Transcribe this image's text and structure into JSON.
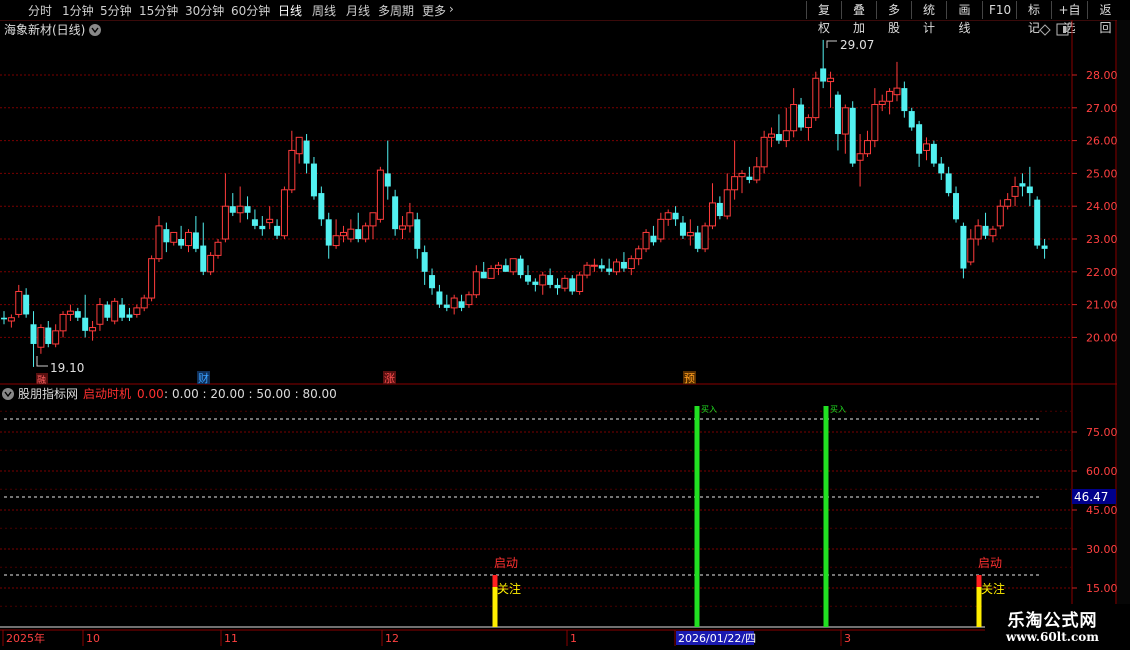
{
  "toolbar": {
    "periods": [
      "分时",
      "1分钟",
      "5分钟",
      "15分钟",
      "30分钟",
      "60分钟",
      "日线",
      "周线",
      "月线",
      "多周期",
      "更多"
    ],
    "active_period": "日线",
    "right_buttons": [
      "复权",
      "叠加",
      "多股",
      "统计",
      "画线",
      "F10",
      "标记",
      "+自选",
      "返回"
    ]
  },
  "chart_header": {
    "title": "海象新材(日线)"
  },
  "price_axis": {
    "labels": [
      "28.00",
      "27.00",
      "26.00",
      "25.00",
      "24.00",
      "23.00",
      "22.00",
      "21.00",
      "20.00"
    ]
  },
  "annotations": {
    "high": "29.07",
    "low": "19.10"
  },
  "event_markers": [
    {
      "text": "财",
      "color": "#3aa0ff"
    },
    {
      "text": "涨",
      "color": "#ff4040"
    },
    {
      "text": "预",
      "color": "#ffa020"
    }
  ],
  "low_marker_glyph": "融",
  "indicator": {
    "name": "股朋指标网",
    "line_name": "启动时机",
    "line_value": "0.00",
    "levels": [
      "0.00",
      "20.00",
      "50.00",
      "80.00"
    ],
    "axis_labels": [
      "75.00",
      "60.00",
      "45.00",
      "30.00",
      "15.00"
    ],
    "current_value": "46.47",
    "signal_start": "启动",
    "signal_watch": "关注",
    "bar_top_label": "买入"
  },
  "date_axis": {
    "labels": [
      "2025年",
      "10",
      "11",
      "12",
      "1",
      "2026/01/22/四",
      "3"
    ]
  },
  "watermark": {
    "title": "乐淘公式网",
    "url": "www.60lt.com"
  },
  "colors": {
    "up": "#ff3c3c",
    "down": "#52f0f0",
    "grid": "#7a0000",
    "green_signal": "#22e022",
    "yellow_signal": "#ffee00",
    "red_signal": "#ff2020"
  },
  "chart_data": {
    "type": "candlestick",
    "title": "海象新材(日线)",
    "ylim": [
      19.1,
      29.07
    ],
    "x_labels": [
      "2025年",
      "10",
      "11",
      "12",
      "1",
      "2026/01/22/四",
      "3"
    ],
    "ohlc": [
      [
        20.6,
        20.8,
        20.4,
        20.55
      ],
      [
        20.5,
        20.7,
        20.3,
        20.6
      ],
      [
        20.7,
        21.6,
        20.6,
        21.4
      ],
      [
        21.3,
        21.5,
        20.6,
        20.7
      ],
      [
        20.4,
        20.8,
        19.1,
        19.8
      ],
      [
        19.7,
        20.4,
        19.5,
        20.3
      ],
      [
        20.3,
        20.5,
        19.7,
        19.8
      ],
      [
        19.8,
        20.4,
        19.7,
        20.2
      ],
      [
        20.2,
        20.8,
        20.0,
        20.7
      ],
      [
        20.7,
        21.0,
        20.5,
        20.8
      ],
      [
        20.8,
        20.9,
        20.5,
        20.6
      ],
      [
        20.6,
        21.3,
        20.0,
        20.2
      ],
      [
        20.2,
        20.5,
        19.9,
        20.3
      ],
      [
        20.4,
        21.2,
        20.2,
        21.0
      ],
      [
        21.0,
        21.1,
        20.5,
        20.6
      ],
      [
        20.5,
        21.2,
        20.4,
        21.1
      ],
      [
        21.0,
        21.2,
        20.5,
        20.6
      ],
      [
        20.7,
        20.9,
        20.5,
        20.6
      ],
      [
        20.7,
        21.0,
        20.6,
        20.9
      ],
      [
        20.9,
        21.3,
        20.8,
        21.2
      ],
      [
        21.2,
        22.5,
        21.1,
        22.4
      ],
      [
        22.4,
        23.7,
        22.3,
        23.4
      ],
      [
        23.3,
        23.5,
        22.6,
        22.9
      ],
      [
        22.9,
        23.2,
        22.8,
        23.2
      ],
      [
        23.0,
        23.4,
        22.7,
        22.8
      ],
      [
        22.8,
        23.3,
        22.6,
        23.2
      ],
      [
        23.2,
        23.7,
        22.6,
        22.7
      ],
      [
        22.8,
        23.5,
        21.9,
        22.0
      ],
      [
        22.0,
        22.6,
        21.9,
        22.5
      ],
      [
        22.5,
        23.0,
        22.4,
        22.9
      ],
      [
        23.0,
        25.0,
        22.9,
        24.0
      ],
      [
        24.0,
        24.4,
        23.7,
        23.8
      ],
      [
        23.8,
        24.6,
        23.5,
        24.0
      ],
      [
        24.0,
        24.3,
        23.6,
        23.8
      ],
      [
        23.6,
        23.9,
        23.3,
        23.4
      ],
      [
        23.4,
        23.7,
        23.1,
        23.3
      ],
      [
        23.5,
        24.0,
        23.3,
        23.6
      ],
      [
        23.4,
        23.6,
        23.0,
        23.1
      ],
      [
        23.1,
        24.6,
        23.0,
        24.5
      ],
      [
        24.5,
        26.3,
        24.4,
        25.7
      ],
      [
        25.6,
        26.0,
        25.3,
        26.1
      ],
      [
        26.0,
        26.2,
        25.0,
        25.3
      ],
      [
        25.3,
        25.5,
        24.2,
        24.3
      ],
      [
        24.4,
        24.6,
        23.4,
        23.6
      ],
      [
        23.6,
        23.8,
        22.4,
        22.8
      ],
      [
        22.8,
        23.6,
        22.7,
        23.1
      ],
      [
        23.1,
        23.4,
        22.9,
        23.2
      ],
      [
        23.0,
        23.6,
        22.9,
        23.3
      ],
      [
        23.3,
        23.8,
        22.9,
        23.0
      ],
      [
        23.0,
        23.5,
        22.9,
        23.4
      ],
      [
        23.4,
        23.8,
        23.0,
        23.8
      ],
      [
        23.6,
        25.2,
        23.5,
        25.1
      ],
      [
        25.0,
        26.0,
        24.2,
        24.6
      ],
      [
        24.3,
        24.5,
        23.1,
        23.3
      ],
      [
        23.3,
        23.7,
        23.0,
        23.4
      ],
      [
        23.4,
        24.1,
        23.2,
        23.8
      ],
      [
        23.6,
        23.8,
        22.4,
        22.7
      ],
      [
        22.6,
        22.8,
        21.6,
        22.0
      ],
      [
        21.9,
        22.1,
        21.3,
        21.5
      ],
      [
        21.4,
        21.6,
        20.9,
        21.0
      ],
      [
        21.0,
        21.3,
        20.8,
        20.9
      ],
      [
        20.9,
        21.3,
        20.7,
        21.2
      ],
      [
        21.1,
        21.3,
        20.8,
        20.9
      ],
      [
        21.0,
        21.4,
        20.9,
        21.3
      ],
      [
        21.3,
        22.2,
        21.2,
        22.0
      ],
      [
        22.0,
        22.3,
        21.8,
        21.8
      ],
      [
        21.8,
        22.2,
        21.8,
        22.1
      ],
      [
        22.1,
        22.3,
        21.9,
        22.2
      ],
      [
        22.2,
        22.4,
        22.0,
        22.0
      ],
      [
        22.0,
        22.4,
        21.9,
        22.4
      ],
      [
        22.4,
        22.5,
        21.8,
        21.9
      ],
      [
        21.9,
        22.2,
        21.6,
        21.7
      ],
      [
        21.7,
        21.8,
        21.4,
        21.6
      ],
      [
        21.6,
        22.0,
        21.3,
        21.9
      ],
      [
        21.9,
        22.1,
        21.5,
        21.6
      ],
      [
        21.6,
        21.8,
        21.3,
        21.5
      ],
      [
        21.5,
        21.9,
        21.4,
        21.8
      ],
      [
        21.8,
        21.9,
        21.3,
        21.4
      ],
      [
        21.4,
        22.0,
        21.3,
        21.9
      ],
      [
        21.9,
        22.3,
        21.8,
        22.2
      ],
      [
        22.2,
        22.4,
        22.0,
        22.2
      ],
      [
        22.2,
        22.4,
        22.0,
        22.1
      ],
      [
        22.1,
        22.4,
        21.9,
        22.0
      ],
      [
        22.0,
        22.4,
        21.9,
        22.3
      ],
      [
        22.3,
        22.6,
        22.0,
        22.1
      ],
      [
        22.1,
        22.5,
        21.9,
        22.4
      ],
      [
        22.4,
        22.8,
        22.2,
        22.7
      ],
      [
        22.7,
        23.3,
        22.6,
        23.2
      ],
      [
        23.1,
        23.4,
        22.8,
        22.9
      ],
      [
        23.0,
        23.8,
        22.9,
        23.6
      ],
      [
        23.6,
        23.9,
        23.4,
        23.8
      ],
      [
        23.8,
        24.0,
        23.4,
        23.6
      ],
      [
        23.5,
        23.7,
        23.0,
        23.1
      ],
      [
        23.1,
        23.6,
        22.8,
        23.2
      ],
      [
        23.2,
        23.4,
        22.6,
        22.7
      ],
      [
        22.7,
        23.5,
        22.6,
        23.4
      ],
      [
        23.4,
        24.7,
        23.3,
        24.1
      ],
      [
        24.1,
        24.3,
        23.6,
        23.7
      ],
      [
        23.7,
        25.0,
        23.6,
        24.5
      ],
      [
        24.5,
        26.0,
        24.2,
        24.9
      ],
      [
        24.9,
        25.1,
        24.4,
        25.0
      ],
      [
        24.9,
        25.2,
        24.7,
        24.8
      ],
      [
        24.8,
        25.5,
        24.7,
        25.2
      ],
      [
        25.2,
        26.3,
        25.0,
        26.1
      ],
      [
        26.1,
        26.4,
        25.8,
        26.2
      ],
      [
        26.2,
        26.8,
        25.9,
        26.0
      ],
      [
        26.0,
        27.0,
        25.8,
        26.3
      ],
      [
        26.3,
        27.6,
        26.1,
        27.1
      ],
      [
        27.1,
        27.3,
        26.3,
        26.4
      ],
      [
        26.4,
        26.8,
        26.0,
        26.7
      ],
      [
        26.7,
        28.1,
        26.6,
        27.9
      ],
      [
        28.2,
        29.07,
        27.6,
        27.8
      ],
      [
        27.8,
        28.1,
        27.0,
        27.9
      ],
      [
        27.4,
        27.5,
        25.7,
        26.2
      ],
      [
        26.2,
        27.1,
        25.6,
        27.0
      ],
      [
        27.0,
        27.2,
        25.2,
        25.3
      ],
      [
        25.4,
        26.2,
        24.6,
        25.6
      ],
      [
        25.6,
        26.3,
        25.5,
        26.0
      ],
      [
        26.0,
        27.6,
        25.8,
        27.1
      ],
      [
        27.1,
        27.4,
        26.9,
        27.2
      ],
      [
        27.2,
        27.6,
        26.8,
        27.5
      ],
      [
        27.4,
        28.4,
        27.2,
        27.6
      ],
      [
        27.6,
        27.8,
        26.7,
        26.9
      ],
      [
        26.9,
        27.0,
        26.3,
        26.4
      ],
      [
        26.5,
        26.6,
        25.2,
        25.6
      ],
      [
        25.7,
        26.1,
        25.4,
        25.9
      ],
      [
        25.9,
        26.0,
        25.2,
        25.3
      ],
      [
        25.3,
        25.5,
        24.8,
        25.0
      ],
      [
        25.0,
        25.2,
        24.3,
        24.4
      ],
      [
        24.4,
        24.6,
        23.5,
        23.6
      ],
      [
        23.4,
        23.5,
        21.8,
        22.1
      ],
      [
        22.3,
        23.3,
        22.2,
        23.0
      ],
      [
        23.0,
        23.6,
        22.8,
        23.4
      ],
      [
        23.4,
        23.8,
        23.0,
        23.1
      ],
      [
        23.1,
        23.4,
        22.9,
        23.3
      ],
      [
        23.4,
        24.2,
        23.3,
        24.0
      ],
      [
        24.0,
        24.4,
        23.9,
        24.2
      ],
      [
        24.3,
        24.9,
        24.0,
        24.6
      ],
      [
        24.7,
        25.0,
        24.3,
        24.6
      ],
      [
        24.6,
        25.2,
        24.0,
        24.4
      ],
      [
        24.2,
        24.3,
        22.7,
        22.8
      ],
      [
        22.8,
        23.0,
        22.4,
        22.7
      ]
    ],
    "indicator_series": {
      "name": "启动时机",
      "levels": [
        0,
        20,
        50,
        80
      ],
      "ylim": [
        0,
        85
      ],
      "events": [
        {
          "bar_index": 0,
          "type": "启动",
          "value": 20
        },
        {
          "bar_index": 1,
          "type": "买入",
          "value": 85
        },
        {
          "bar_index": 2,
          "type": "买入",
          "value": 85
        },
        {
          "bar_index": 3,
          "type": "启动",
          "value": 20
        }
      ]
    }
  }
}
